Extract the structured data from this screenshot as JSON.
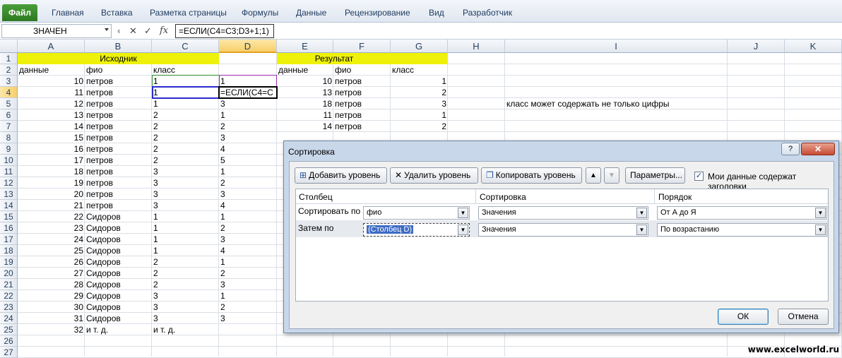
{
  "ribbon": {
    "file_tab": "Файл",
    "tabs": [
      "Главная",
      "Вставка",
      "Разметка страницы",
      "Формулы",
      "Данные",
      "Рецензирование",
      "Вид",
      "Разработчик"
    ]
  },
  "formula_bar": {
    "name_box": "ЗНАЧЕН",
    "cancel_icon": "✕",
    "enter_icon": "✓",
    "fx_icon": "fx",
    "formula": "=ЕСЛИ(C4=C3;D3+1;1)"
  },
  "columns": [
    "A",
    "B",
    "C",
    "D",
    "E",
    "F",
    "G",
    "H",
    "I",
    "J",
    "K"
  ],
  "rows": [
    "1",
    "2",
    "3",
    "4",
    "5",
    "6",
    "7",
    "8",
    "9",
    "10",
    "11",
    "12",
    "13",
    "14",
    "15",
    "16",
    "17",
    "18",
    "19",
    "20",
    "21",
    "22",
    "23",
    "24",
    "25",
    "26",
    "27"
  ],
  "headers": {
    "source": "Исходник",
    "result": "Результат",
    "a2": "данные",
    "b2": "фио",
    "c2": "класс",
    "e2": "данные",
    "f2": "фио",
    "g2": "класс"
  },
  "source_rows": [
    [
      "10",
      "петров",
      "1",
      "1"
    ],
    [
      "11",
      "петров",
      "1",
      "=ЕСЛИ(C4=C"
    ],
    [
      "12",
      "петров",
      "1",
      "3"
    ],
    [
      "13",
      "петров",
      "2",
      "1"
    ],
    [
      "14",
      "петров",
      "2",
      "2"
    ],
    [
      "15",
      "петров",
      "2",
      "3"
    ],
    [
      "16",
      "петров",
      "2",
      "4"
    ],
    [
      "17",
      "петров",
      "2",
      "5"
    ],
    [
      "18",
      "петров",
      "3",
      "1"
    ],
    [
      "19",
      "петров",
      "3",
      "2"
    ],
    [
      "20",
      "петров",
      "3",
      "3"
    ],
    [
      "21",
      "петров",
      "3",
      "4"
    ],
    [
      "22",
      "Сидоров",
      "1",
      "1"
    ],
    [
      "23",
      "Сидоров",
      "1",
      "2"
    ],
    [
      "24",
      "Сидоров",
      "1",
      "3"
    ],
    [
      "25",
      "Сидоров",
      "1",
      "4"
    ],
    [
      "26",
      "Сидоров",
      "2",
      "1"
    ],
    [
      "27",
      "Сидоров",
      "2",
      "2"
    ],
    [
      "28",
      "Сидоров",
      "2",
      "3"
    ],
    [
      "29",
      "Сидоров",
      "3",
      "1"
    ],
    [
      "30",
      "Сидоров",
      "3",
      "2"
    ],
    [
      "31",
      "Сидоров",
      "3",
      "3"
    ],
    [
      "32",
      "и т. д.",
      "и т. д.",
      ""
    ]
  ],
  "result_rows": [
    [
      "10",
      "петров",
      "1"
    ],
    [
      "13",
      "петров",
      "2"
    ],
    [
      "18",
      "петров",
      "3"
    ],
    [
      "11",
      "петров",
      "1"
    ],
    [
      "14",
      "петров",
      "2"
    ]
  ],
  "note": "класс может содержать не только цифры",
  "dialog": {
    "title": "Сортировка",
    "help": "?",
    "close": "✕",
    "add_level": "Добавить уровень",
    "delete_level": "Удалить уровень",
    "copy_level": "Копировать уровень",
    "up_arrow": "▲",
    "down_arrow": "▼",
    "options": "Параметры...",
    "headers_checkbox": "Мои данные содержат заголовки",
    "headers_checked": true,
    "col_header": "Столбец",
    "sort_header": "Сортировка",
    "order_header": "Порядок",
    "level1_label": "Сортировать по",
    "level1_column": "фио",
    "level1_sort": "Значения",
    "level1_order": "От А до Я",
    "level2_label": "Затем по",
    "level2_column": "(Столбец D)",
    "level2_sort": "Значения",
    "level2_order": "По возрастанию",
    "ok": "ОК",
    "cancel": "Отмена"
  },
  "watermark": "www.excelworld.ru",
  "colors": {
    "header_fill": "#eef20b",
    "file_tab": "#2d7a22",
    "selection": "#f8cf6b"
  }
}
